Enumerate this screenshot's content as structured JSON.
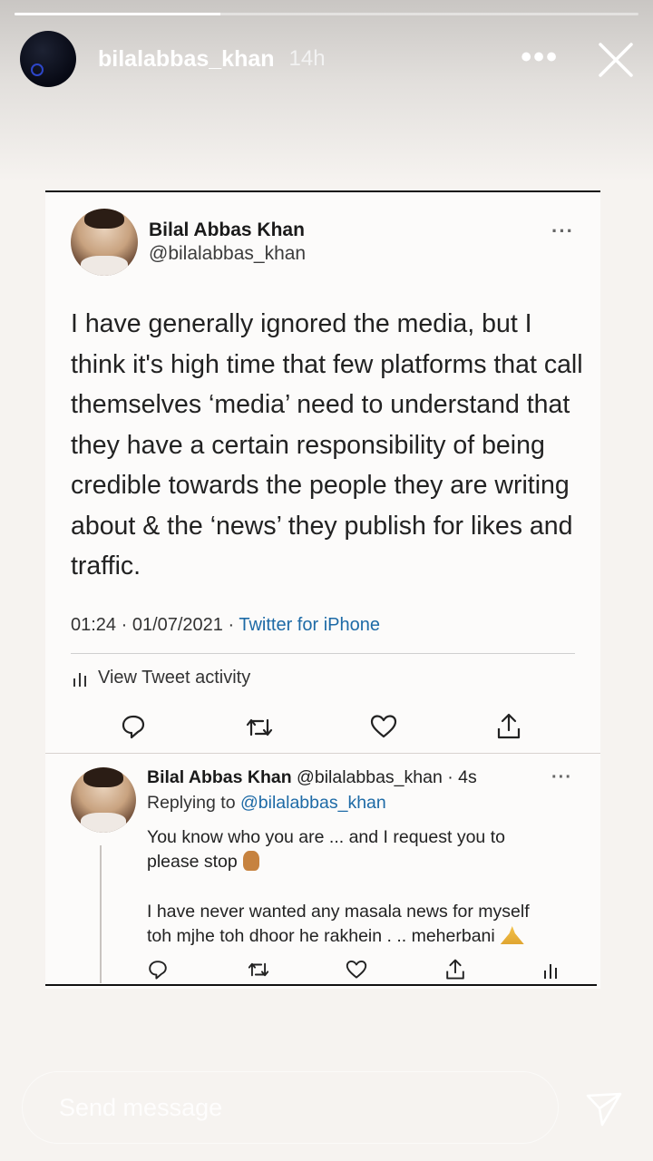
{
  "story": {
    "progress": 0.33,
    "username": "bilalabbas_khan",
    "time": "14h",
    "more_icon": "more-horizontal-icon",
    "close_icon": "close-icon"
  },
  "tweet": {
    "name": "Bilal Abbas Khan",
    "handle": "@bilalabbas_khan",
    "more": "···",
    "text": "I have generally ignored the media, but I think it's high time that few platforms that call themselves ‘media’ need to understand that they have a certain responsibility of being credible towards the people they are writing about & the ‘news’ they publish for likes and traffic.",
    "meta": "01:24 · 01/07/2021 · ",
    "source": "Twitter for iPhone",
    "activity": "View Tweet activity"
  },
  "reply": {
    "name": "Bilal Abbas Khan",
    "handle_time": " @bilalabbas_khan · 4s",
    "replying_prefix": "Replying to ",
    "replying_handle": "@bilalabbas_khan",
    "more": "···",
    "line1": "You know who you are ... and I request you to",
    "line2": "please stop",
    "line3": "I have never wanted any masala news for myself",
    "line4": "toh mjhe toh dhoor he rakhein . .. meherbani"
  },
  "message": {
    "placeholder": "Send message"
  }
}
